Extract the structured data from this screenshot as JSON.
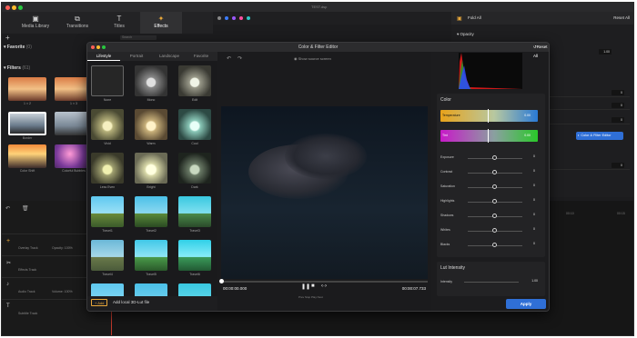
{
  "window": {
    "title": "TEST.dsp"
  },
  "toolbar": {
    "items": [
      {
        "label": "Media Library",
        "icon": "media-library-icon"
      },
      {
        "label": "Transitions",
        "icon": "transitions-icon"
      },
      {
        "label": "Titles",
        "icon": "titles-icon"
      },
      {
        "label": "Effects",
        "icon": "effects-icon",
        "active": true
      }
    ]
  },
  "library": {
    "search_placeholder": "Search",
    "favorite_label": "Favorite",
    "favorite_count": "(0)",
    "filters_label": "Filters",
    "filters_count": "(61)",
    "thumbs": [
      {
        "label": "1 × 2"
      },
      {
        "label": "1 × 3"
      },
      {
        "label": "Border"
      },
      {
        "label": ""
      },
      {
        "label": "Color Shift"
      },
      {
        "label": "Colorful Bubbles"
      }
    ]
  },
  "timeline": {
    "tracks": [
      {
        "label": "Overlay Track"
      },
      {
        "label": "Effects Track"
      },
      {
        "label": "Audio Track"
      },
      {
        "label": "Subtitle Track"
      }
    ],
    "opacity_label": "Opacity: 100%",
    "volume_label": "Volume: 100%",
    "time_marks": [
      "00:00",
      "00:10",
      "00:15"
    ]
  },
  "properties": {
    "title": "Fold All",
    "reset_all": "Reset All",
    "opacity_label": "Opacity",
    "opacity_value": "1.00",
    "rows": [
      "0",
      "0",
      "0",
      "0",
      "0",
      "0",
      "0"
    ],
    "color_filter_button": "Color & Filter Editor"
  },
  "dialog": {
    "title": "Color & Filter Editor",
    "tabs": [
      "Lifestyle",
      "Portrait",
      "Landscape",
      "Favorite"
    ],
    "show_source": "Show source screen",
    "reset_all": "Reset All",
    "filters": [
      {
        "label": "None"
      },
      {
        "label": "Mono"
      },
      {
        "label": "Edit"
      },
      {
        "label": "Vivid"
      },
      {
        "label": "Warm"
      },
      {
        "label": "Cool"
      },
      {
        "label": "Less Even"
      },
      {
        "label": "Bright"
      },
      {
        "label": "Dark"
      },
      {
        "label": "Travel1"
      },
      {
        "label": "Travel2"
      },
      {
        "label": "Travel3"
      },
      {
        "label": "Travel4"
      },
      {
        "label": "Travel5"
      },
      {
        "label": "Travel6"
      }
    ],
    "add_button": "Add",
    "add_lut_text": "Add local 3D-Lut file",
    "time_current": "00:00:00.000",
    "time_total": "00:00:07.733",
    "playback_hint": "Prev  Stop  Play  Next",
    "color_section": "Color",
    "temperature_label": "Temperature",
    "temperature_value": "0.00",
    "tint_label": "Tint",
    "tint_value": "0.00",
    "adjustments": [
      {
        "label": "Exposure",
        "value": "0"
      },
      {
        "label": "Contrast",
        "value": "0"
      },
      {
        "label": "Saturation",
        "value": "0"
      },
      {
        "label": "Highlights",
        "value": "0"
      },
      {
        "label": "Shadows",
        "value": "0"
      },
      {
        "label": "Whites",
        "value": "0"
      },
      {
        "label": "Blacks",
        "value": "0"
      }
    ],
    "lut_section": "Lut Intensity",
    "intensity_label": "Intensity",
    "intensity_value": "1.00",
    "apply": "Apply"
  },
  "colors": {
    "accent": "#2f6fd6",
    "active_tab_icon": "#e9a83a"
  }
}
